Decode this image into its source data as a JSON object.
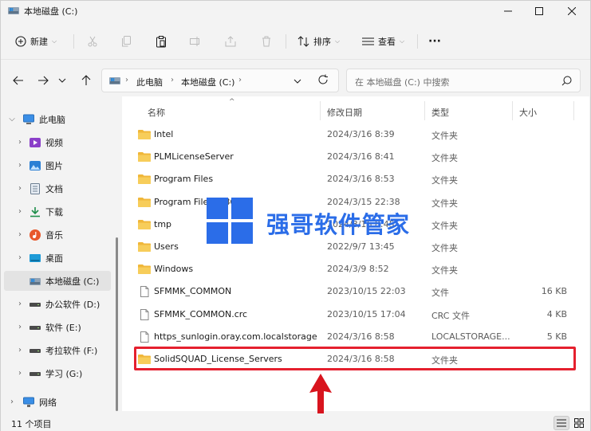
{
  "window": {
    "title": "本地磁盘 (C:)"
  },
  "toolbar": {
    "new_label": "新建",
    "sort_label": "排序",
    "view_label": "查看",
    "more_label": "···"
  },
  "address": {
    "crumbs": [
      "此电脑",
      "本地磁盘 (C:)"
    ]
  },
  "search": {
    "placeholder": "在 本地磁盘 (C:) 中搜索"
  },
  "sidebar": {
    "items": [
      {
        "label": "此电脑",
        "icon": "pc-icon"
      },
      {
        "label": "视频",
        "icon": "video-icon"
      },
      {
        "label": "图片",
        "icon": "pictures-icon"
      },
      {
        "label": "文档",
        "icon": "documents-icon"
      },
      {
        "label": "下载",
        "icon": "download-icon"
      },
      {
        "label": "音乐",
        "icon": "music-icon"
      },
      {
        "label": "桌面",
        "icon": "desktop-icon"
      },
      {
        "label": "本地磁盘 (C:)",
        "icon": "drive-c-icon"
      },
      {
        "label": "办公软件 (D:)",
        "icon": "drive-icon"
      },
      {
        "label": "软件 (E:)",
        "icon": "drive-icon"
      },
      {
        "label": "考拉软件 (F:)",
        "icon": "drive-icon"
      },
      {
        "label": "学习 (G:)",
        "icon": "drive-icon"
      },
      {
        "label": "网络",
        "icon": "network-icon"
      }
    ]
  },
  "columns": {
    "name": "名称",
    "modified": "修改日期",
    "type": "类型",
    "size": "大小"
  },
  "files": [
    {
      "name": "Intel",
      "modified": "2024/3/16 8:39",
      "type": "文件夹",
      "size": "",
      "kind": "folder"
    },
    {
      "name": "PLMLicenseServer",
      "modified": "2024/3/16 8:41",
      "type": "文件夹",
      "size": "",
      "kind": "folder"
    },
    {
      "name": "Program Files",
      "modified": "2024/3/16 8:53",
      "type": "文件夹",
      "size": "",
      "kind": "folder"
    },
    {
      "name": "Program Files (x86)",
      "modified": "2024/3/15 22:38",
      "type": "文件夹",
      "size": "",
      "kind": "folder"
    },
    {
      "name": "tmp",
      "modified": "2024/3/16 8:45",
      "type": "文件夹",
      "size": "",
      "kind": "folder"
    },
    {
      "name": "Users",
      "modified": "2022/9/7 13:45",
      "type": "文件夹",
      "size": "",
      "kind": "folder"
    },
    {
      "name": "Windows",
      "modified": "2024/3/9 8:52",
      "type": "文件夹",
      "size": "",
      "kind": "folder"
    },
    {
      "name": "SFMMK_COMMON",
      "modified": "2023/10/15 22:03",
      "type": "文件",
      "size": "16 KB",
      "kind": "file"
    },
    {
      "name": "SFMMK_COMMON.crc",
      "modified": "2023/10/15 17:04",
      "type": "CRC 文件",
      "size": "4 KB",
      "kind": "file"
    },
    {
      "name": "https_sunlogin.oray.com.localstorage",
      "modified": "2024/3/16 8:58",
      "type": "LOCALSTORAGE...",
      "size": "5 KB",
      "kind": "file"
    },
    {
      "name": "SolidSQUAD_License_Servers",
      "modified": "2024/3/16 8:58",
      "type": "文件夹",
      "size": "",
      "kind": "folder"
    }
  ],
  "watermark": {
    "text": "强哥软件管家"
  },
  "status": {
    "count_text": "11 个项目"
  },
  "colors": {
    "accent": "#2b6de8",
    "highlight": "#e5202e",
    "folder": "#f5c342"
  }
}
